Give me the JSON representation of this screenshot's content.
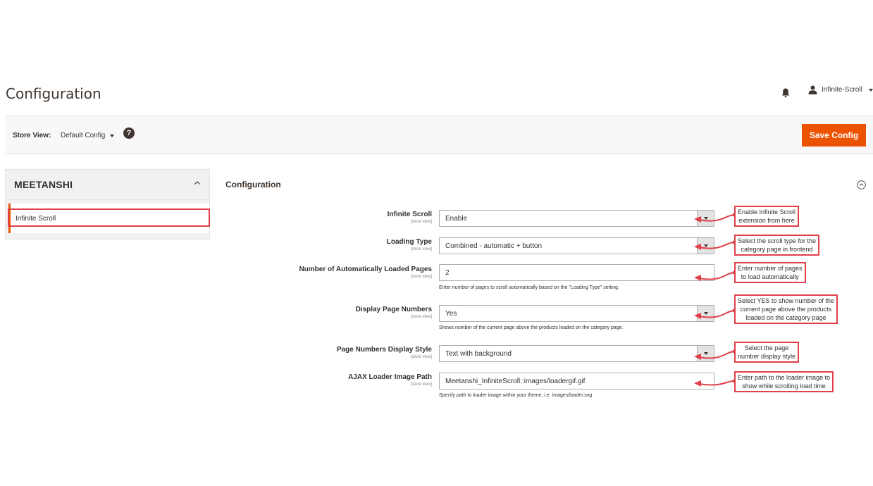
{
  "header": {
    "title": "Configuration",
    "user_name": "Infinite-Scroll"
  },
  "store_bar": {
    "label": "Store View:",
    "selected": "Default Config",
    "help": "?",
    "save_label": "Save Config"
  },
  "sidebar": {
    "logo": "MEETANSHI",
    "items": [
      {
        "label": "Infinite Scroll"
      }
    ]
  },
  "section": {
    "title": "Configuration"
  },
  "fields": [
    {
      "label": "Infinite Scroll",
      "scope": "[store view]",
      "value": "Enable",
      "type": "select",
      "note": ""
    },
    {
      "label": "Loading Type",
      "scope": "[store view]",
      "value": "Combined - automatic + button",
      "type": "select",
      "note": ""
    },
    {
      "label": "Number of Automatically Loaded Pages",
      "scope": "[store view]",
      "value": "2",
      "type": "text",
      "note": "Enter number of pages to scroll automatically based on the \"Loading Type\" setting."
    },
    {
      "label": "Display Page Numbers",
      "scope": "[store view]",
      "value": "Yes",
      "type": "select",
      "note": "Shows number of the current page above the products loaded on the category page."
    },
    {
      "label": "Page Numbers Display Style",
      "scope": "[store view]",
      "value": "Text with background",
      "type": "select",
      "note": ""
    },
    {
      "label": "AJAX Loader Image Path",
      "scope": "[store view]",
      "value": "Meetanshi_InfiniteScroll::images/loadergif.gif",
      "type": "text",
      "note": "Specify path to loader image within your theme, i.e. images/loader.svg"
    }
  ],
  "callouts": [
    {
      "line1": "Enable Infinite Scroll",
      "line2": "extension from here",
      "line3": ""
    },
    {
      "line1": "Select the scroll type for the",
      "line2": "category page in frontend",
      "line3": ""
    },
    {
      "line1": "Enter number of pages",
      "line2": "to load automatically",
      "line3": ""
    },
    {
      "line1": "Select YES to show number of the",
      "line2": "current page above the products",
      "line3": "loaded on the category page"
    },
    {
      "line1": "Select the page",
      "line2": "number display style",
      "line3": ""
    },
    {
      "line1": "Enter path to the loader image to",
      "line2": "show while scrolling load time",
      "line3": ""
    }
  ],
  "colors": {
    "accent": "#eb5202",
    "callout_border": "#e0404a"
  }
}
